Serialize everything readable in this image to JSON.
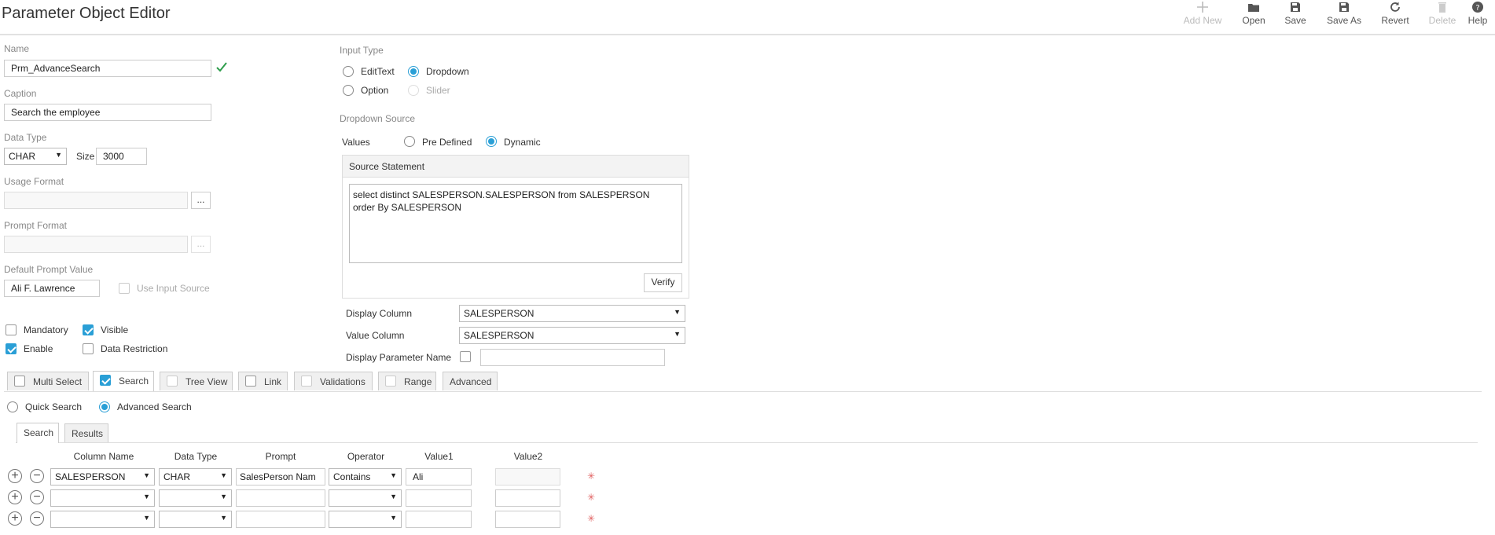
{
  "title": "Parameter Object Editor",
  "toolbar": {
    "add_new": "Add New",
    "open": "Open",
    "save": "Save",
    "save_as": "Save As",
    "revert": "Revert",
    "delete": "Delete",
    "help": "Help"
  },
  "form": {
    "name_label": "Name",
    "name_value": "Prm_AdvanceSearch",
    "caption_label": "Caption",
    "caption_value": "Search the employee",
    "data_type_label": "Data Type",
    "data_type_value": "CHAR",
    "size_label": "Size",
    "size_value": "3000",
    "usage_format_label": "Usage Format",
    "usage_format_value": "",
    "prompt_format_label": "Prompt Format",
    "prompt_format_value": "",
    "browse_label": "...",
    "default_prompt_label": "Default Prompt Value",
    "default_prompt_value": "Ali F. Lawrence",
    "use_input_source": "Use Input Source",
    "mandatory": "Mandatory",
    "visible": "Visible",
    "enable": "Enable",
    "data_restriction": "Data Restriction"
  },
  "input_type": {
    "label": "Input Type",
    "edittext": "EditText",
    "dropdown": "Dropdown",
    "option": "Option",
    "slider": "Slider",
    "selected": "Dropdown"
  },
  "dropdown_source": {
    "label": "Dropdown Source",
    "values_label": "Values",
    "predefined": "Pre Defined",
    "dynamic": "Dynamic",
    "selected": "Dynamic",
    "source_statement_title": "Source Statement",
    "source_statement": "select distinct SALESPERSON.SALESPERSON from SALESPERSON\norder By SALESPERSON",
    "verify": "Verify",
    "display_column_label": "Display Column",
    "display_column_value": "SALESPERSON",
    "value_column_label": "Value Column",
    "value_column_value": "SALESPERSON",
    "display_param_name_label": "Display Parameter Name",
    "display_param_name_value": ""
  },
  "feature_tabs": {
    "multi_select": "Multi Select",
    "search": "Search",
    "tree_view": "Tree View",
    "link": "Link",
    "validations": "Validations",
    "range": "Range",
    "advanced": "Advanced",
    "active": "Search"
  },
  "search_mode": {
    "quick": "Quick Search",
    "advanced": "Advanced Search",
    "selected": "Advanced Search"
  },
  "sub_tabs": {
    "search": "Search",
    "results": "Results",
    "active": "Search"
  },
  "grid": {
    "headers": [
      "Column Name",
      "Data Type",
      "Prompt",
      "Operator",
      "Value1",
      "Value2"
    ],
    "rows": [
      {
        "column_name": "SALESPERSON",
        "data_type": "CHAR",
        "prompt": "SalesPerson Nam",
        "operator": "Contains",
        "value1": "Ali",
        "value2": ""
      },
      {
        "column_name": "",
        "data_type": "",
        "prompt": "",
        "operator": "",
        "value1": "",
        "value2": ""
      },
      {
        "column_name": "",
        "data_type": "",
        "prompt": "",
        "operator": "",
        "value1": "",
        "value2": ""
      }
    ],
    "add_symbol": "+",
    "remove_symbol": "−",
    "required_symbol": "✳"
  },
  "colors": {
    "accent": "#2a9fd6",
    "valid": "#2e9d4c",
    "required": "#e06060"
  }
}
